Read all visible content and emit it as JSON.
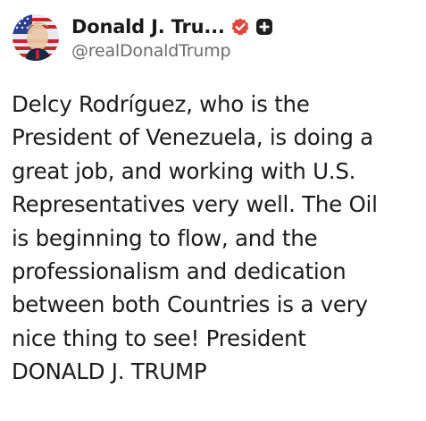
{
  "post": {
    "author": {
      "display_name": "Donald J. Tru...",
      "handle": "@realDonaldTrump",
      "verified_badge_icon": "verified-badge-icon",
      "plus_badge_icon": "plus-badge-icon",
      "avatar_icon": "avatar-image"
    },
    "body_lines": [
      "Delcy Rodríguez, who is the",
      "President of Venezuela, is doing a",
      "great job, and working with U.S.",
      "Representatives very well. The Oil",
      "is beginning to flow, and the",
      "professionalism and dedication",
      "between both Countries is a very",
      "nice thing to see! President",
      "DONALD J. TRUMP"
    ]
  },
  "colors": {
    "verified_badge": "#e0483e",
    "plus_badge": "#1f1f1f",
    "handle_text": "#6b6b6b",
    "body_text": "#1c1c1c"
  }
}
